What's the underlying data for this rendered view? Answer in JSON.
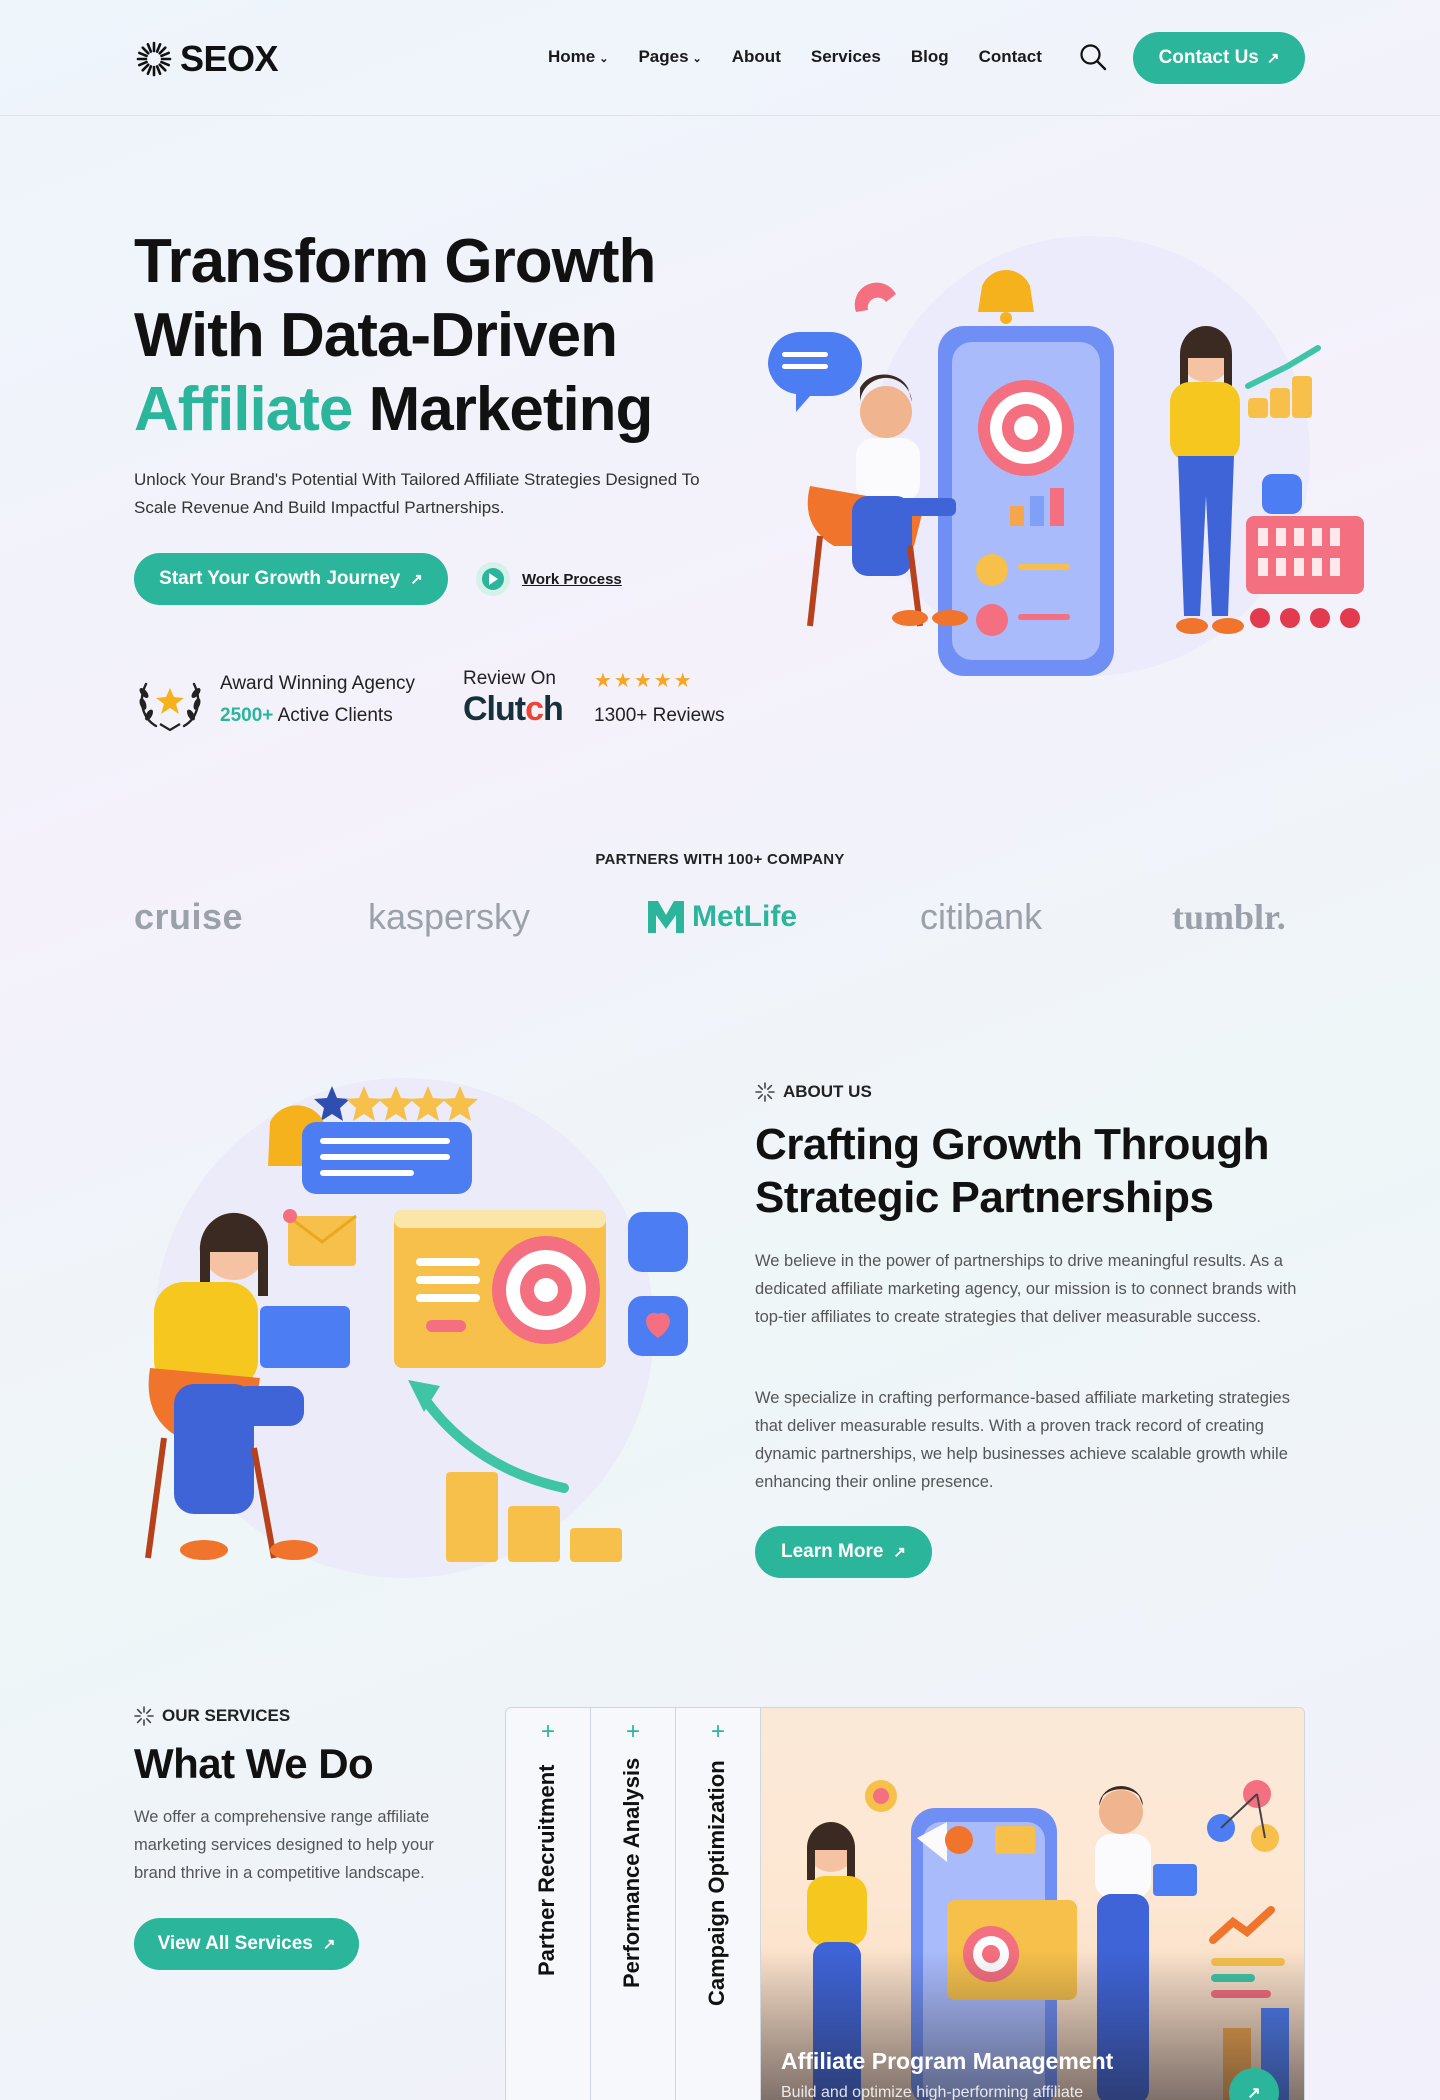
{
  "header": {
    "logo_text": "SEOX",
    "nav": [
      {
        "label": "Home",
        "has_dropdown": true
      },
      {
        "label": "Pages",
        "has_dropdown": true
      },
      {
        "label": "About",
        "has_dropdown": false
      },
      {
        "label": "Services",
        "has_dropdown": false
      },
      {
        "label": "Blog",
        "has_dropdown": false
      },
      {
        "label": "Contact",
        "has_dropdown": false
      }
    ],
    "cta_label": "Contact Us"
  },
  "hero": {
    "title_line1": "Transform Growth",
    "title_line2": "With Data-Driven",
    "title_accent": "Affiliate",
    "title_end": "Marketing",
    "subtitle": "Unlock Your Brand's Potential With Tailored Affiliate Strategies Designed To Scale Revenue And Build Impactful Partnerships.",
    "primary_button": "Start Your Growth Journey",
    "secondary_link": "Work Process",
    "award_line1": "Award Winning Agency",
    "award_count": "2500+",
    "award_count_label": "Active Clients",
    "clutch_review_label": "Review On",
    "clutch_logo": "Clutch",
    "rating_stars": 5,
    "reviews_label": "1300+ Reviews"
  },
  "partners": {
    "title": "PARTNERS WITH 100+ COMPANY",
    "logos": [
      "cruise",
      "kaspersky",
      "MetLife",
      "citibank",
      "tumblr."
    ]
  },
  "about": {
    "tag": "ABOUT US",
    "title": "Crafting Growth Through Strategic Partnerships",
    "paragraph1": "We believe in the power of partnerships to drive meaningful results. As a dedicated affiliate marketing agency, our mission is to connect brands with top-tier affiliates to create strategies that deliver measurable success.",
    "paragraph2": "We specialize in crafting performance-based affiliate marketing strategies that deliver measurable results. With a proven track record of creating dynamic partnerships, we help businesses achieve scalable growth while enhancing their online presence.",
    "button": "Learn More"
  },
  "services": {
    "tag": "OUR SERVICES",
    "title": "What We Do",
    "description": "We offer a comprehensive range  affiliate marketing services designed to help your brand thrive in a competitive landscape.",
    "button": "View All Services",
    "tabs": [
      "Partner Recruitment",
      "Performance Analysis",
      "Campaign Optimization"
    ],
    "featured_title": "Affiliate Program Management",
    "featured_desc": "Build and optimize high-performing affiliate"
  },
  "colors": {
    "accent": "#2bb59b",
    "text": "#111111",
    "star": "#f6a623"
  }
}
